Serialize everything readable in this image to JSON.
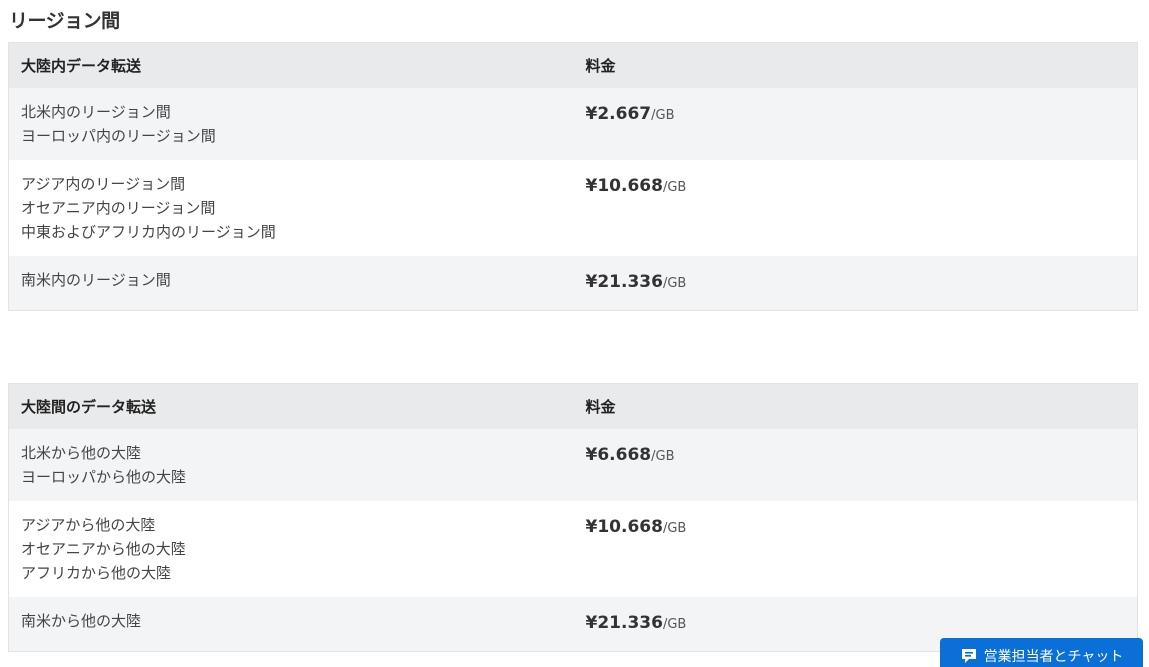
{
  "section": {
    "title": "リージョン間"
  },
  "intra": {
    "header": {
      "region": "大陸内データ転送",
      "price": "料金"
    },
    "rows": [
      {
        "regions": [
          "北米内のリージョン間",
          "ヨーロッパ内のリージョン間"
        ],
        "amount": "¥2.667",
        "unit": "/GB"
      },
      {
        "regions": [
          "アジア内のリージョン間",
          "オセアニア内のリージョン間",
          "中東およびアフリカ内のリージョン間"
        ],
        "amount": "¥10.668",
        "unit": "/GB"
      },
      {
        "regions": [
          "南米内のリージョン間"
        ],
        "amount": "¥21.336",
        "unit": "/GB"
      }
    ]
  },
  "inter": {
    "header": {
      "region": "大陸間のデータ転送",
      "price": "料金"
    },
    "rows": [
      {
        "regions": [
          "北米から他の大陸",
          "ヨーロッパから他の大陸"
        ],
        "amount": "¥6.668",
        "unit": "/GB"
      },
      {
        "regions": [
          "アジアから他の大陸",
          "オセアニアから他の大陸",
          "アフリカから他の大陸"
        ],
        "amount": "¥10.668",
        "unit": "/GB"
      },
      {
        "regions": [
          "南米から他の大陸"
        ],
        "amount": "¥21.336",
        "unit": "/GB"
      }
    ]
  },
  "chat": {
    "label": "営業担当者とチャット",
    "icon": "chat-bubble-icon",
    "color": "#0a6fd6"
  }
}
